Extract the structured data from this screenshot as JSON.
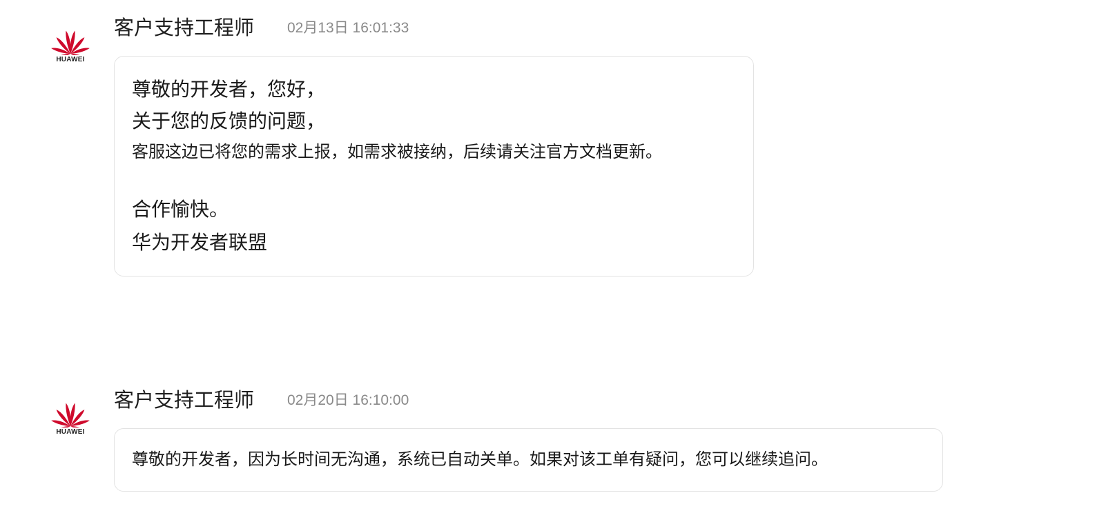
{
  "messages": [
    {
      "sender": "客户支持工程师",
      "timestamp": "02月13日 16:01:33",
      "avatar_text": "HUAWEI",
      "lines": [
        "尊敬的开发者，您好，",
        "关于您的反馈的问题，",
        "客服这边已将您的需求上报，如需求被接纳，后续请关注官方文档更新。",
        "合作愉快。",
        "华为开发者联盟"
      ]
    },
    {
      "sender": "客户支持工程师",
      "timestamp": "02月20日 16:10:00",
      "avatar_text": "HUAWEI",
      "lines": [
        "尊敬的开发者，因为长时间无沟通，系统已自动关单。如果对该工单有疑问，您可以继续追问。"
      ]
    }
  ],
  "colors": {
    "brand": "#CF0A2C",
    "bubble_border": "#E3E3E3",
    "timestamp": "#8A8A8A"
  },
  "icons": {
    "avatar": "huawei-logo-icon"
  }
}
